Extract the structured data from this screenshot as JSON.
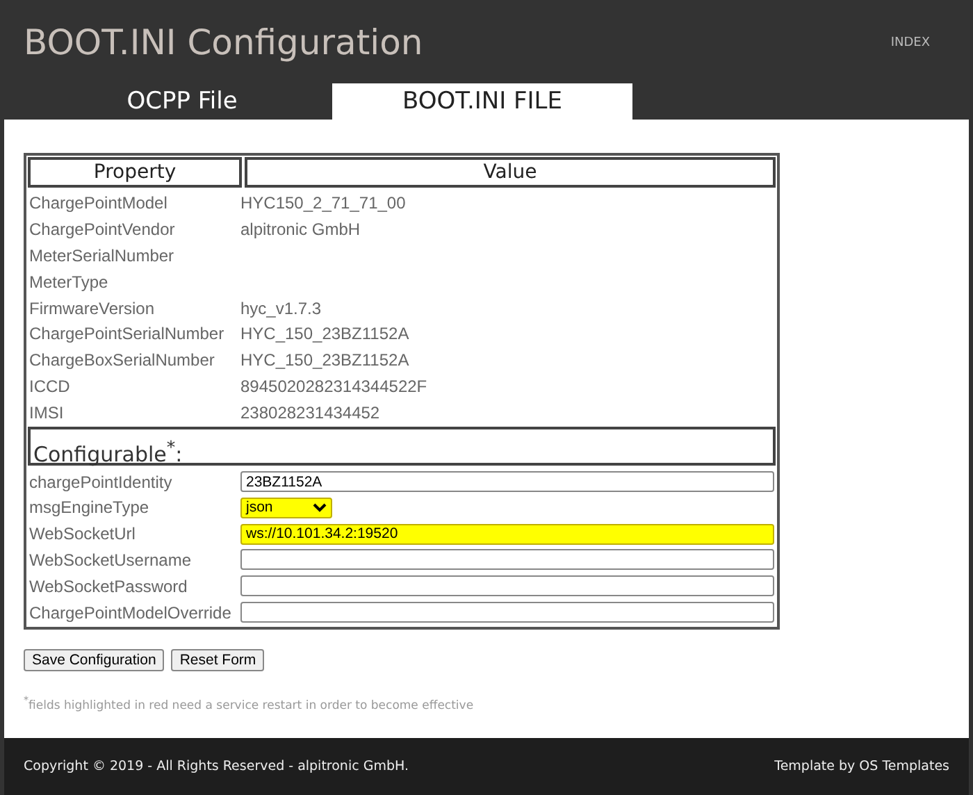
{
  "header": {
    "title": "BOOT.INI Configuration",
    "nav_link": "INDEX"
  },
  "tabs": [
    {
      "label": "OCPP File",
      "selected": false
    },
    {
      "label": "BOOT.INI FILE",
      "selected": true
    }
  ],
  "table": {
    "columns": [
      "Property",
      "Value"
    ],
    "rows": [
      {
        "property": "ChargePointModel",
        "value": "HYC150_2_71_71_00"
      },
      {
        "property": "ChargePointVendor",
        "value": "alpitronic GmbH"
      },
      {
        "property": "MeterSerialNumber"
      },
      {
        "property": "MeterType"
      },
      {
        "property": "FirmwareVersion",
        "value": "hyc_v1.7.3"
      },
      {
        "property": "ChargePointSerialNumber",
        "value": "HYC_150_23BZ1152A"
      },
      {
        "property": "ChargeBoxSerialNumber",
        "value": "HYC_150_23BZ1152A"
      },
      {
        "property": "ICCD",
        "value": "8945020282314344522F"
      },
      {
        "property": "IMSI",
        "value": "238028231434452"
      }
    ],
    "section_heading": "Configurable$^{*}$:",
    "fields": [
      {
        "label": "chargePointIdentity",
        "kind": "text",
        "value": "23BZ1152A",
        "highlighted": false
      },
      {
        "label": "msgEngineType",
        "kind": "select",
        "value": "json",
        "highlighted": true
      },
      {
        "label": "WebSocketUrl",
        "kind": "text",
        "value": "ws://10.101.34.2:19520",
        "highlighted": true
      },
      {
        "label": "WebSocketUsername",
        "kind": "text",
        "highlighted": false
      },
      {
        "label": "WebSocketPassword",
        "kind": "text",
        "highlighted": false
      },
      {
        "label": "ChargePointModelOverride",
        "kind": "text",
        "highlighted": false
      }
    ]
  },
  "buttons": [
    "Save Configuration",
    "Reset Form"
  ],
  "note": "$^{*}$fields highlighted in red need a service restart in order to become effective",
  "footer": {
    "copyright": "Copyright © 2019 - All Rights Reserved - alpitronic GmbH.",
    "credit": "Template by OS Templates"
  }
}
